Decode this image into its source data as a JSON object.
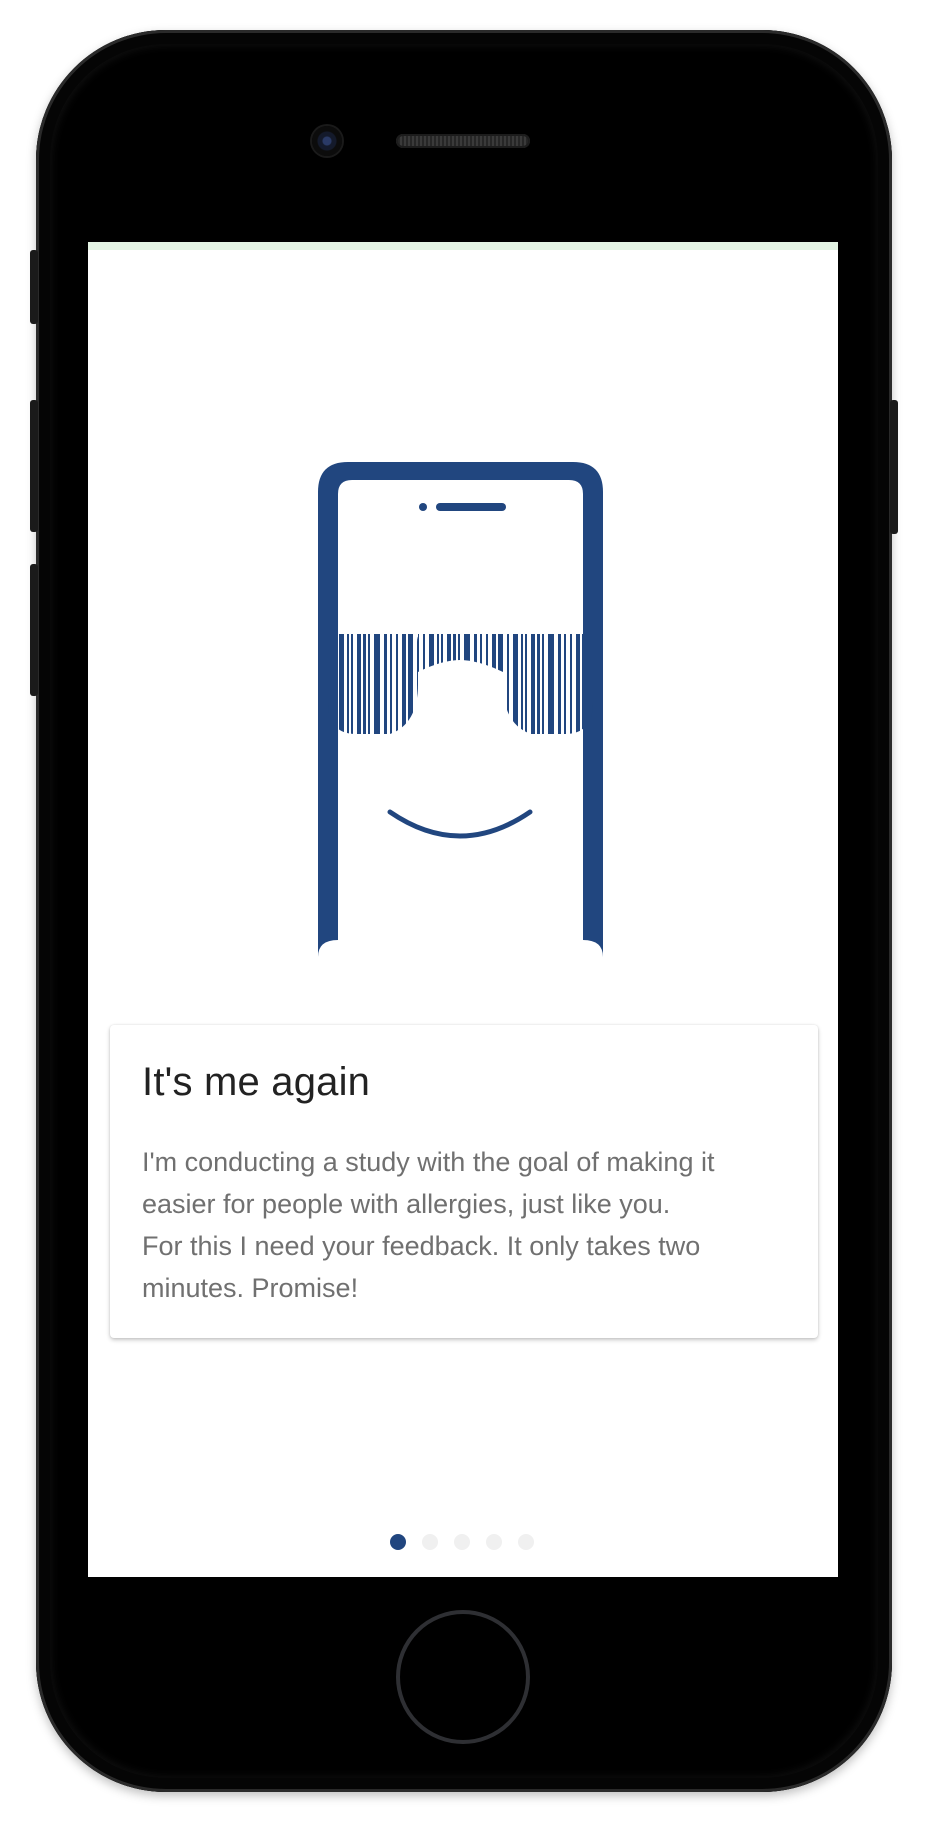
{
  "colors": {
    "brand_blue": "#21467f",
    "progress_green": "#e4f4e4",
    "dot_inactive": "#f0f0f0",
    "title_text": "#222222",
    "body_text": "#707070"
  },
  "illustration": {
    "subject": "phone-with-barcode-sunglasses-smiling-face"
  },
  "card": {
    "title": "It's me again",
    "body_lines": [
      "I'm conducting a study with the goal of making it",
      "easier for people with allergies, just like you.",
      "For this I need your feedback. It only takes two",
      "minutes. Promise!"
    ]
  },
  "pager": {
    "page_count": 5,
    "current_page": 1
  }
}
